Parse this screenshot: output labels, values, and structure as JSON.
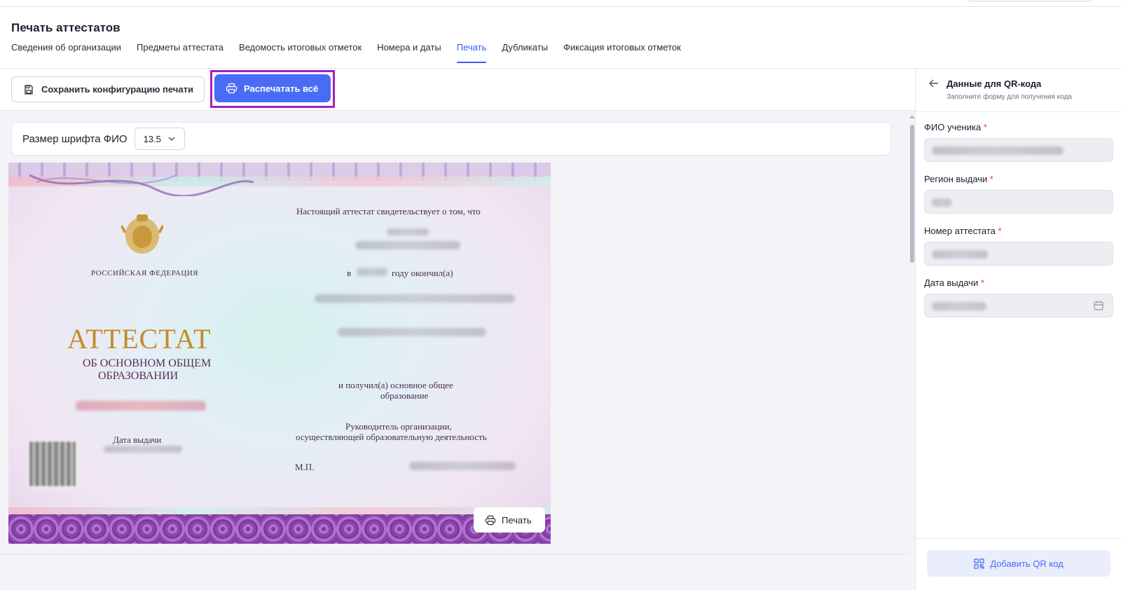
{
  "header": {
    "title": "Печать аттестатов",
    "tabs": [
      {
        "label": "Сведения об организации",
        "active": false
      },
      {
        "label": "Предметы аттестата",
        "active": false
      },
      {
        "label": "Ведомость итоговых отметок",
        "active": false
      },
      {
        "label": "Номера и даты",
        "active": false
      },
      {
        "label": "Печать",
        "active": true
      },
      {
        "label": "Дубликаты",
        "active": false
      },
      {
        "label": "Фиксация итоговых отметок",
        "active": false
      }
    ]
  },
  "toolbar": {
    "save_label": "Сохранить конфигурацию печати",
    "print_all_label": "Распечатать всё",
    "save_icon": "save-icon",
    "print_icon": "printer-icon"
  },
  "font_size": {
    "label": "Размер шрифта ФИО",
    "value": "13.5"
  },
  "certificate": {
    "country": "РОССИЙСКАЯ ФЕДЕРАЦИЯ",
    "title": "АТТЕСТАТ",
    "subtitle_line1": "ОБ ОСНОВНОМ ОБЩЕМ",
    "subtitle_line2": "ОБРАЗОВАНИИ",
    "date_label": "Дата выдачи",
    "statement": "Настоящий аттестат свидетельствует о том, что",
    "year_prefix": "в",
    "year_suffix": "году окончил(а)",
    "received_line1": "и получил(а) основное общее",
    "received_line2": "образование",
    "head_line1": "Руководитель организации,",
    "head_line2": "осуществляющей образовательную деятельность",
    "stamp_label": "М.П.",
    "print_label": "Печать"
  },
  "qr_panel": {
    "title": "Данные для QR-кода",
    "subtitle": "Заполните форму для получения кода",
    "fields": [
      {
        "label": "ФИО ученика",
        "required_mark": "*"
      },
      {
        "label": "Регион выдачи",
        "required_mark": "*"
      },
      {
        "label": "Номер аттестата",
        "required_mark": "*"
      },
      {
        "label": "Дата выдачи",
        "required_mark": "*"
      }
    ],
    "add_button_label": "Добавить QR код"
  },
  "colors": {
    "accent": "#4a6cf5",
    "highlight_frame": "#a51fc0",
    "required": "#e4373c"
  }
}
